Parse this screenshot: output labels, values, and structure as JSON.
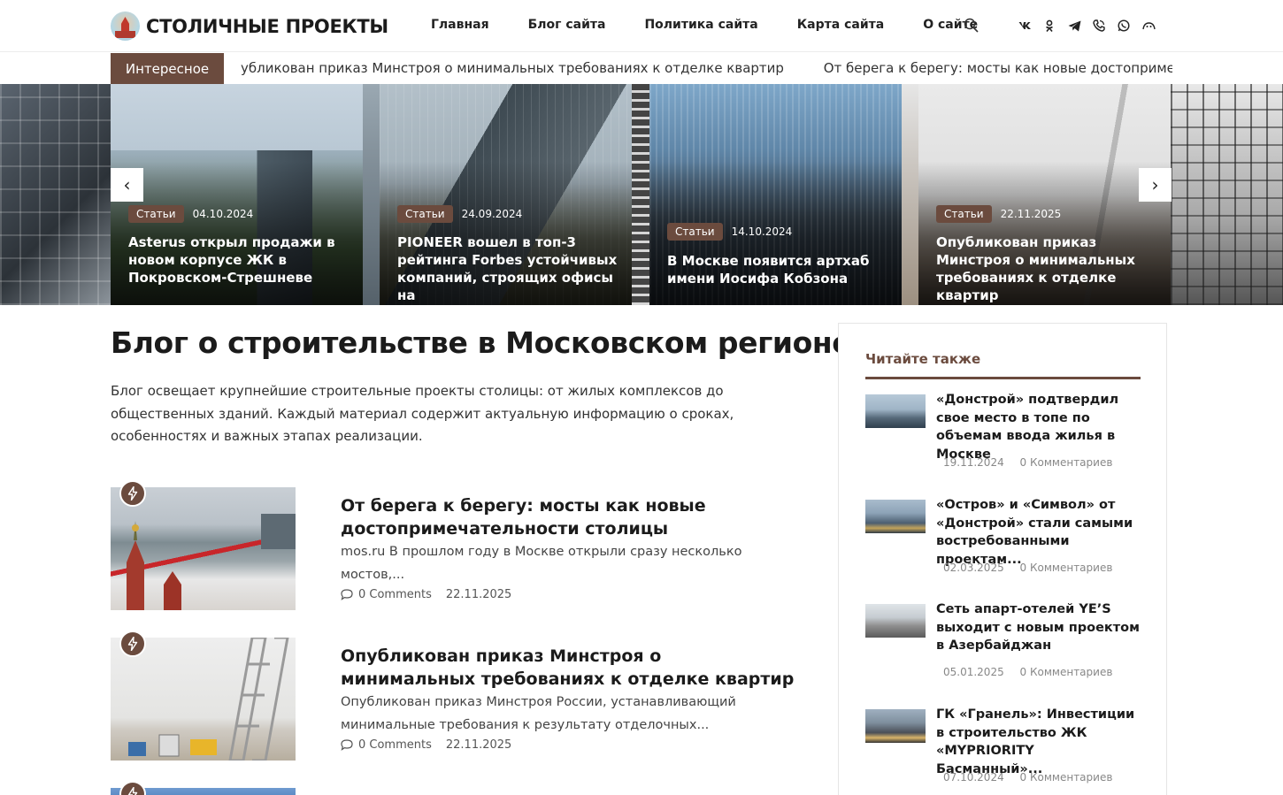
{
  "site": {
    "logo_text": "СТОЛИЧНЫЕ ПРОЕКТЫ"
  },
  "nav": {
    "items": [
      "Главная",
      "Блог сайта",
      "Политика сайта",
      "Карта сайта",
      "О сайте"
    ]
  },
  "socials": [
    "vk-icon",
    "ok-icon",
    "telegram-icon",
    "viber-icon",
    "whatsapp-icon",
    "max-icon"
  ],
  "ticker": {
    "label": "Интересное",
    "items": [
      "убликован приказ Минстроя о минимальных требованиях к отделке квартир",
      "От берега к берегу: мосты как новые достопримечательнос"
    ]
  },
  "slider": {
    "prev": "‹",
    "next": "›",
    "slides": [
      {
        "badge": "Статьи",
        "date": "04.10.2024",
        "title": "Asterus открыл продажи в новом корпусе ЖК в Покровском-Стрешневе"
      },
      {
        "badge": "Статьи",
        "date": "24.09.2024",
        "title": "PIONEER вошел в топ-3 рейтинга Forbes устойчивых компаний, строящих офисы на"
      },
      {
        "badge": "Статьи",
        "date": "14.10.2024",
        "title": "В Москве появится артхаб имени Иосифа Кобзона"
      },
      {
        "badge": "Статьи",
        "date": "22.11.2025",
        "title": "Опубликован приказ Минстроя о минимальных требованиях к отделке квартир"
      }
    ]
  },
  "main": {
    "title": "Блог о строительстве в Московском регионе",
    "intro": "Блог освещает крупнейшие строительные проекты столицы: от жилых комплексов до общественных зданий. Каждый материал содержит актуальную информацию о сроках, особенностях и важных этапах реализации.",
    "posts": [
      {
        "title": "От берега к берегу: мосты как новые достопримечательности столицы",
        "excerpt": "mos.ru В прошлом году в Москве открыли сразу несколько мостов,...",
        "comments": "0 Comments",
        "date": "22.11.2025"
      },
      {
        "title": "Опубликован приказ Минстроя о минимальных требованиях к отделке квартир",
        "excerpt": "Опубликован приказ Минстроя России, устанавливающий минимальные требования к результату отделочных...",
        "comments": "0 Comments",
        "date": "22.11.2025"
      }
    ]
  },
  "sidebar": {
    "title": "Читайте также",
    "items": [
      {
        "title": "«Донстрой» подтвердил свое место в топе по объемам ввода жилья в Москве",
        "date": "19.11.2024",
        "comments": "0 Комментариев"
      },
      {
        "title": "«Остров» и «Символ» от «Донстрой» стали самыми востребованными проектам...",
        "date": "02.03.2025",
        "comments": "0 Комментариев"
      },
      {
        "title": "Сеть апарт-отелей YE’S выходит с новым проектом в Азербайджан",
        "date": "05.01.2025",
        "comments": "0 Комментариев"
      },
      {
        "title": "ГК «Гранель»: Инвестиции в строительство ЖК «MYPRIORITY Басманный»...",
        "date": "07.10.2024",
        "comments": "0 Комментариев"
      }
    ]
  },
  "colors": {
    "accent": "#6b4b3e"
  }
}
